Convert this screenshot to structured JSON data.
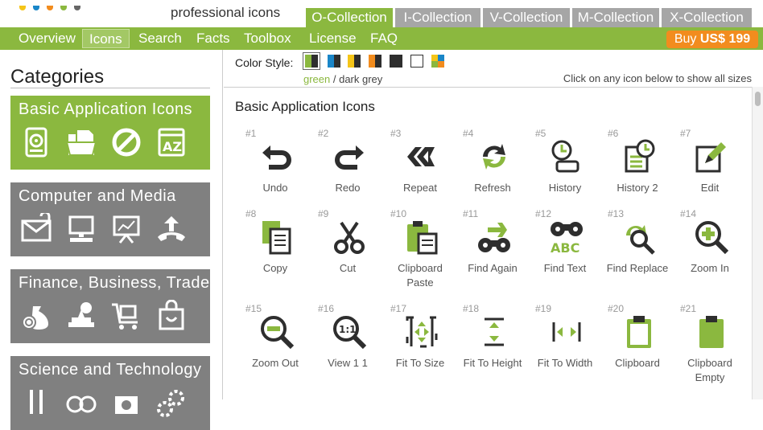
{
  "header": {
    "tagline": "professional icons",
    "collections": [
      "O-Collection",
      "I-Collection",
      "V-Collection",
      "M-Collection",
      "X-Collection"
    ],
    "active_collection": "O-Collection"
  },
  "nav": {
    "items": [
      "Overview",
      "Icons",
      "Search",
      "Facts",
      "Toolbox",
      "License",
      "FAQ"
    ],
    "active": "Icons",
    "buy": {
      "label": "Buy ",
      "price": "US$ 199"
    }
  },
  "sidebar": {
    "heading": "Categories",
    "categories": [
      {
        "title": "Basic Application Icons",
        "color": "#8bb83f",
        "icons": [
          "hard-disk-icon",
          "open-folder-icon",
          "forbidden-icon",
          "sort-az-icon"
        ]
      },
      {
        "title": "Computer and Media",
        "color": "#808080",
        "icons": [
          "email-attachment-icon",
          "computer-icon",
          "presentation-board-icon",
          "phone-upload-icon"
        ]
      },
      {
        "title": "Finance, Business, Trade",
        "color": "#808080",
        "icons": [
          "money-bag-icon",
          "stamp-icon",
          "shopping-cart-icon",
          "shopping-bag-icon"
        ]
      },
      {
        "title": "Science and Technology",
        "color": "#808080",
        "icons": [
          "tool-icon",
          "binoculars-icon",
          "camera-icon",
          "gears-icon"
        ]
      }
    ]
  },
  "toolbar": {
    "color_style_label": "Color Style:",
    "swatch_caption": {
      "green": "green",
      "sep": " / ",
      "rest": "dark grey"
    },
    "hint": "Click on any icon below to show all sizes",
    "colors": {
      "accent": "#8bb83f",
      "dark": "#2e2e2e",
      "orange": "#f28c1e",
      "blue": "#1a86c8",
      "yellow": "#f5c518"
    }
  },
  "panel": {
    "title": "Basic Application Icons",
    "icons": [
      {
        "num": "#1",
        "label": "Undo",
        "icon": "undo-icon"
      },
      {
        "num": "#2",
        "label": "Redo",
        "icon": "redo-icon"
      },
      {
        "num": "#3",
        "label": "Repeat",
        "icon": "repeat-icon"
      },
      {
        "num": "#4",
        "label": "Refresh",
        "icon": "refresh-icon"
      },
      {
        "num": "#5",
        "label": "History",
        "icon": "history-icon"
      },
      {
        "num": "#6",
        "label": "History 2",
        "icon": "history-2-icon"
      },
      {
        "num": "#7",
        "label": "Edit",
        "icon": "edit-icon"
      },
      {
        "num": "#8",
        "label": "Copy",
        "icon": "copy-icon"
      },
      {
        "num": "#9",
        "label": "Cut",
        "icon": "cut-icon"
      },
      {
        "num": "#10",
        "label": "Clipboard Paste",
        "icon": "clipboard-paste-icon"
      },
      {
        "num": "#11",
        "label": "Find Again",
        "icon": "find-again-icon"
      },
      {
        "num": "#12",
        "label": "Find Text",
        "icon": "find-text-icon"
      },
      {
        "num": "#13",
        "label": "Find Replace",
        "icon": "find-replace-icon"
      },
      {
        "num": "#14",
        "label": "Zoom In",
        "icon": "zoom-in-icon"
      },
      {
        "num": "#15",
        "label": "Zoom Out",
        "icon": "zoom-out-icon"
      },
      {
        "num": "#16",
        "label": "View 1 1",
        "icon": "view-1-1-icon"
      },
      {
        "num": "#17",
        "label": "Fit To Size",
        "icon": "fit-to-size-icon"
      },
      {
        "num": "#18",
        "label": "Fit To Height",
        "icon": "fit-to-height-icon"
      },
      {
        "num": "#19",
        "label": "Fit To Width",
        "icon": "fit-to-width-icon"
      },
      {
        "num": "#20",
        "label": "Clipboard",
        "icon": "clipboard-icon"
      },
      {
        "num": "#21",
        "label": "Clipboard Empty",
        "icon": "clipboard-empty-icon"
      }
    ]
  }
}
